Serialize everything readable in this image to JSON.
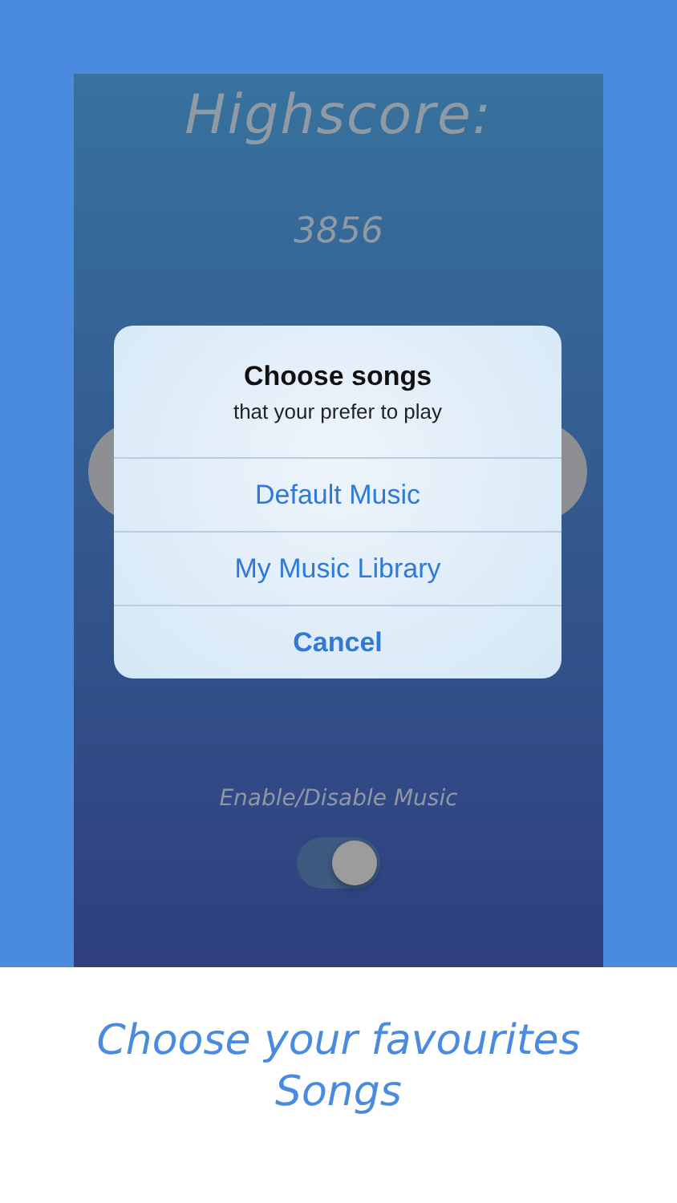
{
  "game": {
    "title": "Highscore:",
    "score": "3856",
    "music_label": "Enable/Disable Music",
    "music_on": true
  },
  "dialog": {
    "title": "Choose songs",
    "message": "that your prefer to play",
    "actions": [
      {
        "label": "Default Music",
        "kind": "default"
      },
      {
        "label": "My Music Library",
        "kind": "default"
      },
      {
        "label": "Cancel",
        "kind": "cancel"
      }
    ]
  },
  "caption": {
    "lines": [
      "Choose your favourites",
      "Songs"
    ]
  }
}
